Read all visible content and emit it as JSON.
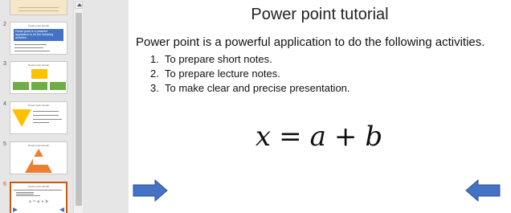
{
  "thumbnails": [
    {
      "number": "2",
      "title": "Power point tutorial",
      "text": "Power point is a powerful application to do the following activities."
    },
    {
      "number": "3",
      "title": "Power point tutorial"
    },
    {
      "number": "4",
      "title": "Power point tutorial"
    },
    {
      "number": "5",
      "title": "Power point tutorial"
    },
    {
      "number": "6",
      "title": "Power point tutorial",
      "formula": "x = a + b"
    }
  ],
  "slide": {
    "title": "Power point tutorial",
    "intro": "Power point is a powerful application to do the following activities.",
    "items": [
      {
        "num": "1.",
        "text": "To prepare short notes."
      },
      {
        "num": "2.",
        "text": "To prepare lecture notes."
      },
      {
        "num": "3.",
        "text": "To make clear and precise presentation."
      }
    ],
    "formula": {
      "x": "x",
      "eq": "=",
      "a": "a",
      "plus": "+",
      "b": "b"
    }
  },
  "colors": {
    "arrow_fill": "#4472c4",
    "arrow_stroke": "#2f5597",
    "active_thumb_border": "#c55a11",
    "thumb2_box": "#4472c4",
    "thumb3_green": "#70ad47",
    "thumb3_yellow": "#ffc000",
    "thumb4_yellow": "#ffc000",
    "thumb5_orange": "#ed7d31"
  }
}
